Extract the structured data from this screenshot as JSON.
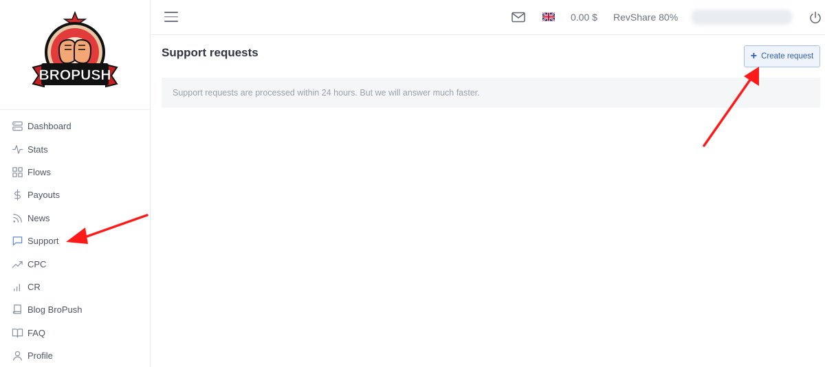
{
  "brand": {
    "logo_text": "BROPUSH"
  },
  "sidebar": {
    "items": [
      {
        "label": "Dashboard",
        "icon": "dashboard-icon"
      },
      {
        "label": "Stats",
        "icon": "activity-icon"
      },
      {
        "label": "Flows",
        "icon": "grid-icon"
      },
      {
        "label": "Payouts",
        "icon": "dollar-icon"
      },
      {
        "label": "News",
        "icon": "rss-icon"
      },
      {
        "label": "Support",
        "icon": "chat-icon"
      },
      {
        "label": "CPC",
        "icon": "trending-up-icon"
      },
      {
        "label": "CR",
        "icon": "bar-chart-icon"
      },
      {
        "label": "Blog BroPush",
        "icon": "book-icon"
      },
      {
        "label": "FAQ",
        "icon": "open-book-icon"
      },
      {
        "label": "Profile",
        "icon": "user-icon"
      }
    ]
  },
  "header": {
    "balance": "0.00 $",
    "revshare": "RevShare 80%",
    "language_flag": "uk-flag-icon"
  },
  "main": {
    "title": "Support requests",
    "create_button_label": "Create request",
    "notice": "Support requests are processed within 24 hours. But we will answer much faster."
  },
  "colors": {
    "accent": "#2e5fb2",
    "annotation": "#ff1a1a"
  }
}
